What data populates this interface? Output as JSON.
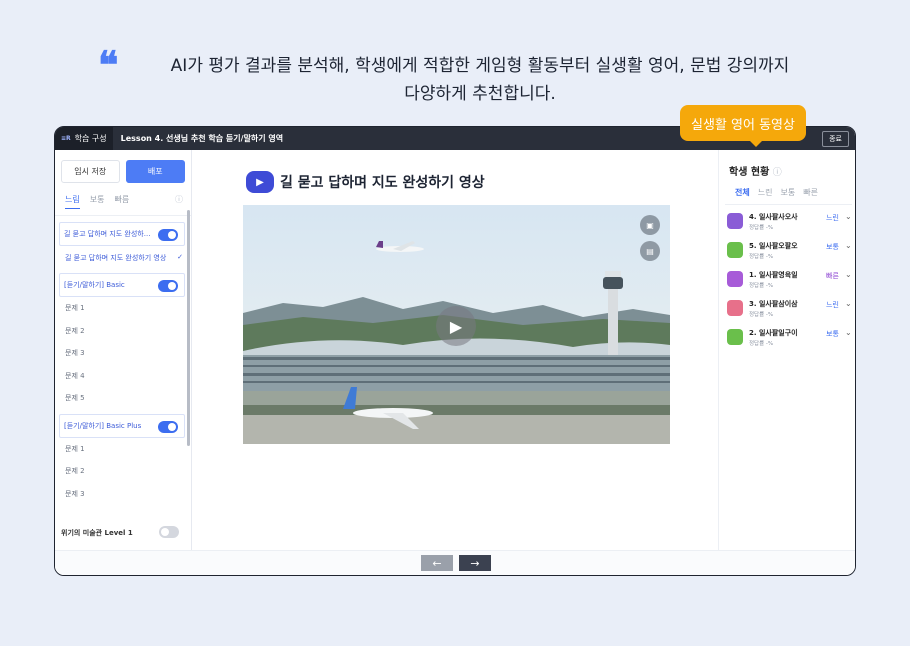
{
  "headline": {
    "line1": "AI가 평가 결과를 분석해, 학생에게 적합한 게임형 활동부터 실생활 영어, 문법 강의까지",
    "line2": "다양하게 추천합니다."
  },
  "callout": "실생활 영어 동영상",
  "topbar": {
    "menu_label": "학습 구성",
    "lesson_title": "Lesson 4. 선생님 추천 학습 듣기/말하기 영역",
    "end_button": "종료"
  },
  "left": {
    "save": "임시 저장",
    "deploy": "배포",
    "tabs": [
      "느림",
      "보통",
      "빠름"
    ],
    "item1": "길 묻고 답하며 지도 완성하...",
    "item1_sub": "길 묻고 답하며 지도 완성하기 영상",
    "group1": "[듣기/말하기] Basic",
    "group1_q": [
      "문제 1",
      "문제 2",
      "문제 3",
      "문제 4",
      "문제 5"
    ],
    "group2": "[듣기/말하기] Basic Plus",
    "group2_q": [
      "문제 1",
      "문제 2",
      "문제 3"
    ],
    "bottom": "위기의 미술관 Level 1"
  },
  "main": {
    "title": "길 묻고 답하며 지도 완성하기 영상"
  },
  "right": {
    "title": "학생 현황",
    "tabs": [
      "전체",
      "느린",
      "보통",
      "빠른"
    ],
    "students": [
      {
        "name": "4. 일사팔사오사",
        "rate": "정답률 -%",
        "level": "느린",
        "color": "#3c6df0",
        "avatar": "#8a5cd6"
      },
      {
        "name": "5. 일사팔오팔오",
        "rate": "정답률 -%",
        "level": "보통",
        "color": "#3c6df0",
        "avatar": "#6abf4b"
      },
      {
        "name": "1. 일사팔영육일",
        "rate": "정답률 -%",
        "level": "빠른",
        "color": "#8a3fd1",
        "avatar": "#a75bd8"
      },
      {
        "name": "3. 일사팔삼이삼",
        "rate": "정답률 -%",
        "level": "느린",
        "color": "#3c6df0",
        "avatar": "#e7708a"
      },
      {
        "name": "2. 일사팔일구이",
        "rate": "정답률 -%",
        "level": "보통",
        "color": "#3c6df0",
        "avatar": "#6abf4b"
      }
    ]
  }
}
